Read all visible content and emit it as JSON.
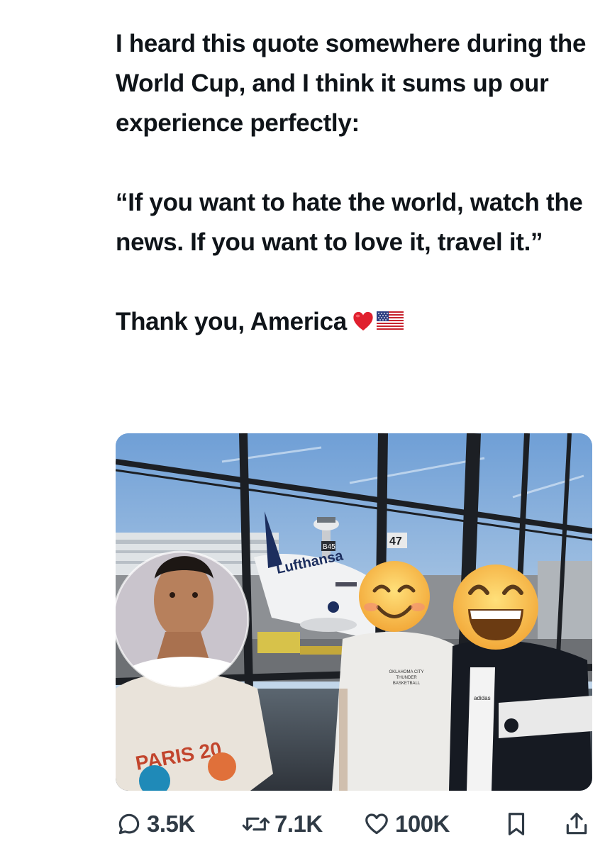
{
  "tweet": {
    "lines_p1": "I heard this quote somewhere during the World Cup, and I think it sums up our experience perfectly:",
    "quote": "“If you want to hate the world, watch the news. If you want to love it, travel it.”",
    "closing": "Thank you, America",
    "closing_emojis": [
      "red-heart",
      "us-flag"
    ]
  },
  "media": {
    "gate_sign_1": "B45",
    "gate_sign_2": "47",
    "airline_text": "Lufthansa",
    "shirt_text": [
      "OKLAHOMA CITY",
      "THUNDER",
      "BASKETBALL"
    ],
    "left_shirt_text": "PARIS 20",
    "jacket_brand": "adidas",
    "face_emojis": [
      "smiling-face-with-smiling-eyes",
      "grinning-face-with-smiling-eyes"
    ]
  },
  "actions": {
    "reply_count": "3.5K",
    "retweet_count": "7.1K",
    "like_count": "100K"
  },
  "colors": {
    "text": "#0f1419",
    "action_text": "#2f3a45",
    "heart": "#e0202e"
  }
}
